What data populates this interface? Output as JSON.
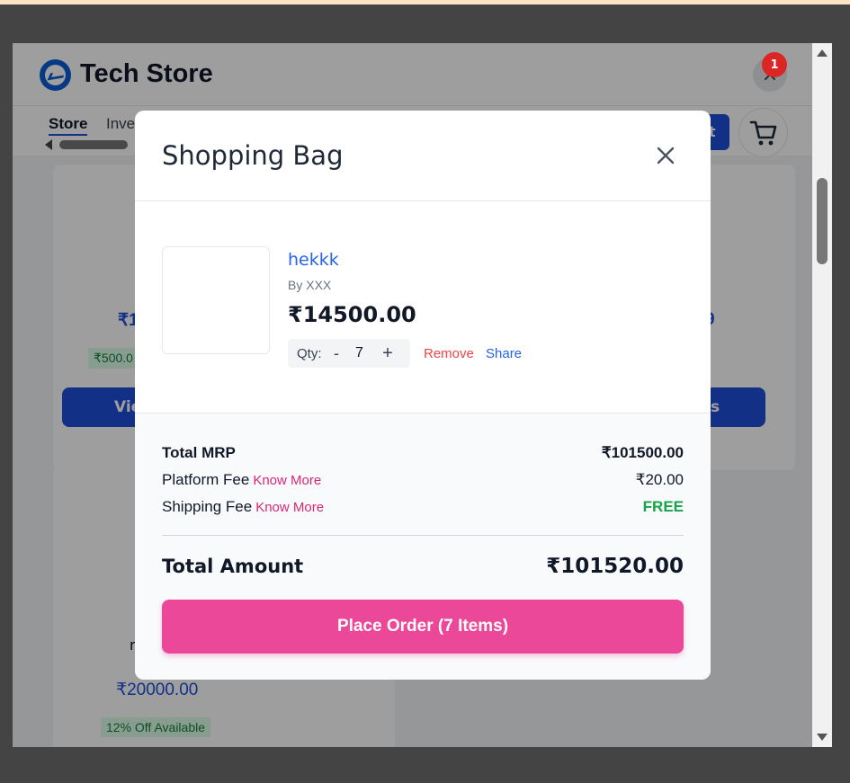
{
  "app": {
    "store_name": "Tech Store",
    "close_label": "×"
  },
  "tabs": [
    {
      "label": "Store"
    },
    {
      "label": "Inve"
    }
  ],
  "header": {
    "action_button_partial": "t",
    "cart_count": "1"
  },
  "background": {
    "card1_price_partial": "₹1",
    "card1_offer_partial": "₹500.0",
    "card1_view_partial": "Vie",
    "card2_price_partial": "9",
    "card2_view_partial": "s",
    "card3_name_partial": "n",
    "card3_price": "₹20000.00",
    "card3_offer": "12% Off Available"
  },
  "modal": {
    "title": "Shopping Bag",
    "close_label": "✕",
    "item": {
      "name": "hekkk",
      "by": "By XXX",
      "price": "₹14500.00",
      "qty_label": "Qty:",
      "qty_minus": "-",
      "qty_value": "7",
      "qty_plus": "+",
      "remove_label": "Remove",
      "share_label": "Share"
    },
    "summary": {
      "total_mrp_label": "Total MRP",
      "total_mrp_value": "₹101500.00",
      "platform_fee_label": "Platform Fee",
      "platform_fee_link": "Know More",
      "platform_fee_value": "₹20.00",
      "shipping_fee_label": "Shipping Fee",
      "shipping_fee_link": "Know More",
      "shipping_fee_value": "FREE",
      "total_amount_label": "Total Amount",
      "total_amount_value": "₹101520.00"
    },
    "place_order_label": "Place Order (7 Items)"
  },
  "colors": {
    "accent_pink": "#ec4899",
    "link_blue": "#2563eb",
    "remove_red": "#ef4444",
    "free_green": "#16a34a",
    "badge_red": "#dc2626"
  }
}
